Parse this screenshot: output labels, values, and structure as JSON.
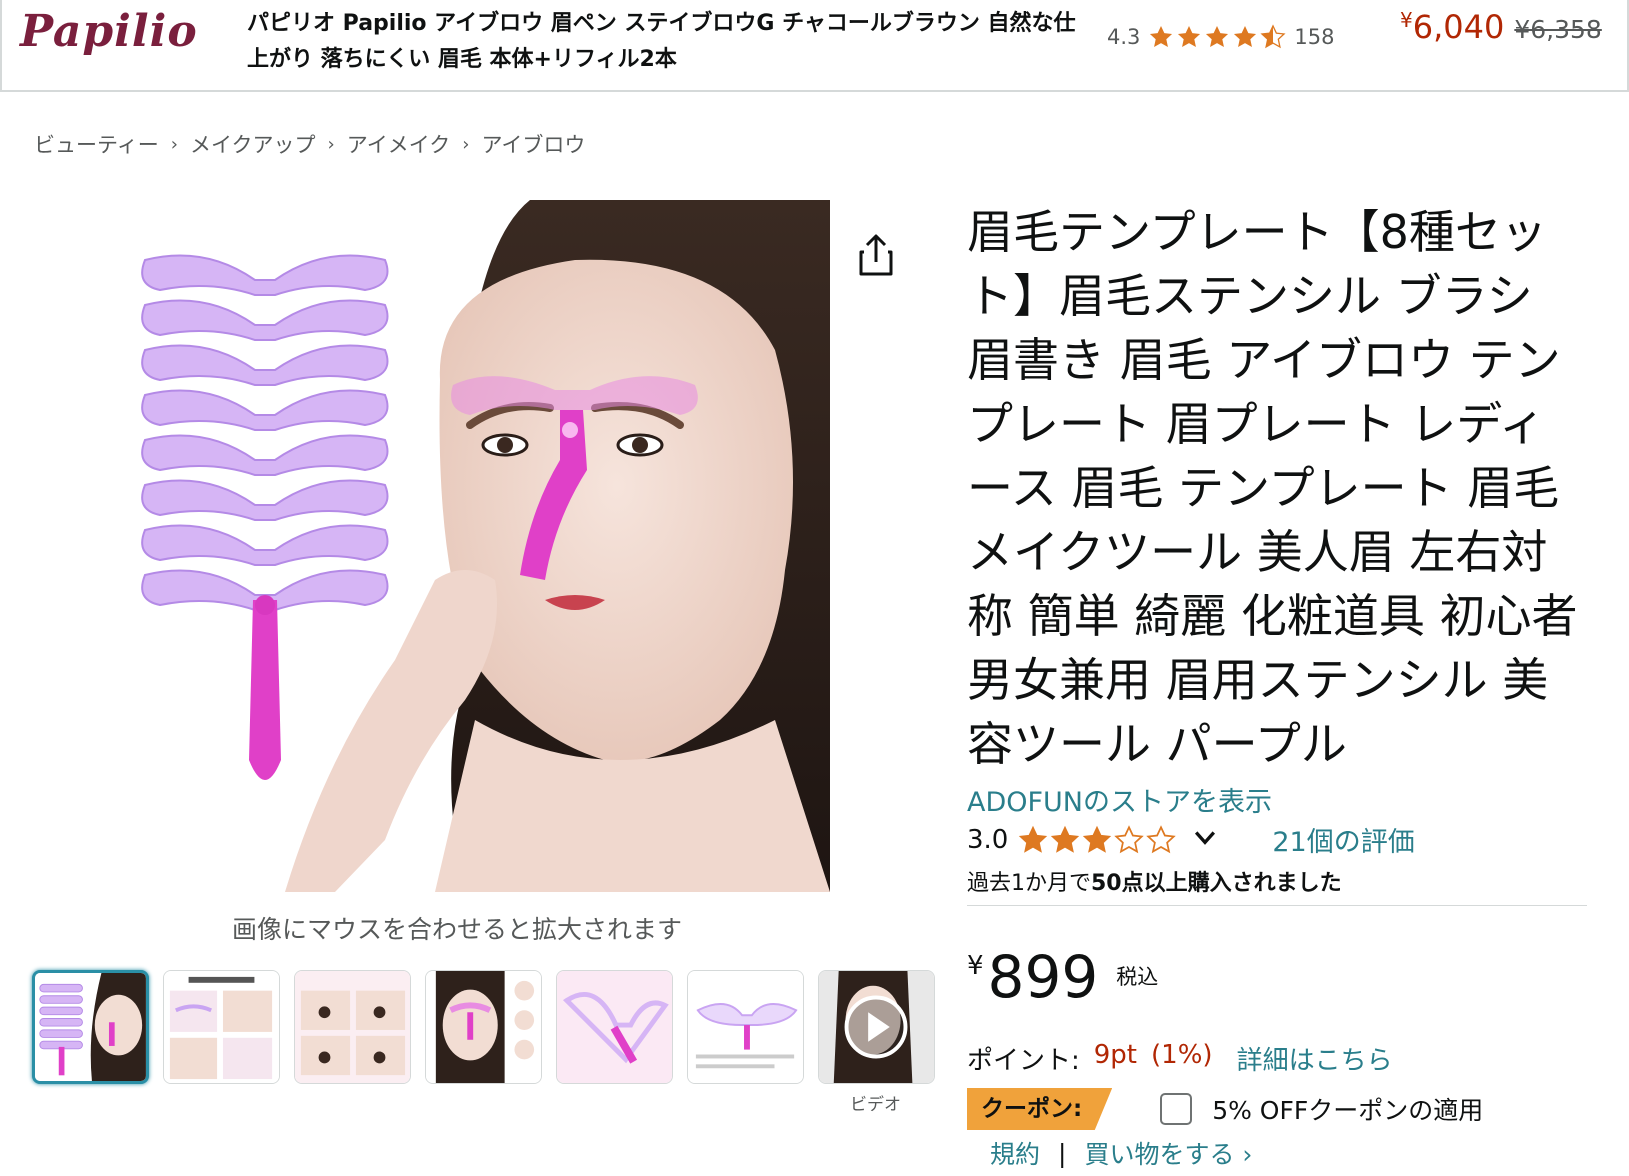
{
  "banner": {
    "brand_logo": "Papilio",
    "title": "パピリオ Papilio アイブロウ 眉ペン ステイブロウG チャコールブラウン 自然な仕上がり 落ちにくい 眉毛 本体+リフィル2本",
    "rating_value": "4.3",
    "rating_count": "158",
    "price_symbol": "¥",
    "price": "6,040",
    "list_price": "¥6,358"
  },
  "breadcrumb": [
    "ビューティー",
    "メイクアップ",
    "アイメイク",
    "アイブロウ"
  ],
  "breadcrumb_separator": "›",
  "image": {
    "hover_hint": "画像にマウスを合わせると拡大されます",
    "video_label": "ビデオ"
  },
  "product": {
    "title": "眉毛テンプレート【8種セット】眉毛ステンシル ブラシ 眉書き 眉毛 アイブロウ テンプレート 眉プレート レディース 眉毛 テンプレート 眉毛メイクツール 美人眉 左右対称 簡単 綺麗 化粧道具 初心者 男女兼用 眉用ステンシル 美容ツール パープル",
    "store_link": "ADOFUNのストアを表示",
    "rating_value": "3.0",
    "reviews_link": "21個の評価",
    "bought_prefix": "過去1か月で",
    "bought_bold": "50点以上購入されました"
  },
  "price": {
    "symbol": "¥",
    "amount": "899",
    "tax_note": "税込"
  },
  "points": {
    "label": "ポイント:",
    "value": "9pt",
    "percent": "(1%)",
    "details_link": "詳細はこちら"
  },
  "coupon": {
    "badge": "クーポン:",
    "text": "5% OFFクーポンの適用",
    "checked": false
  },
  "terms": {
    "terms_link": "規約",
    "separator": "|",
    "shop_link": "買い物をする ›"
  },
  "colors": {
    "link": "#2a7e8b",
    "price_red": "#b12704",
    "star": "#de7921",
    "coupon_badge": "#f0a23b",
    "template_purple": "#c9a4f2",
    "template_magenta": "#e040c8",
    "selected_thumb": "#2a8fa6"
  },
  "icons": {
    "share": "share-icon",
    "chevron": "chevron-down-icon",
    "play": "play-icon",
    "star": "star-icon"
  }
}
